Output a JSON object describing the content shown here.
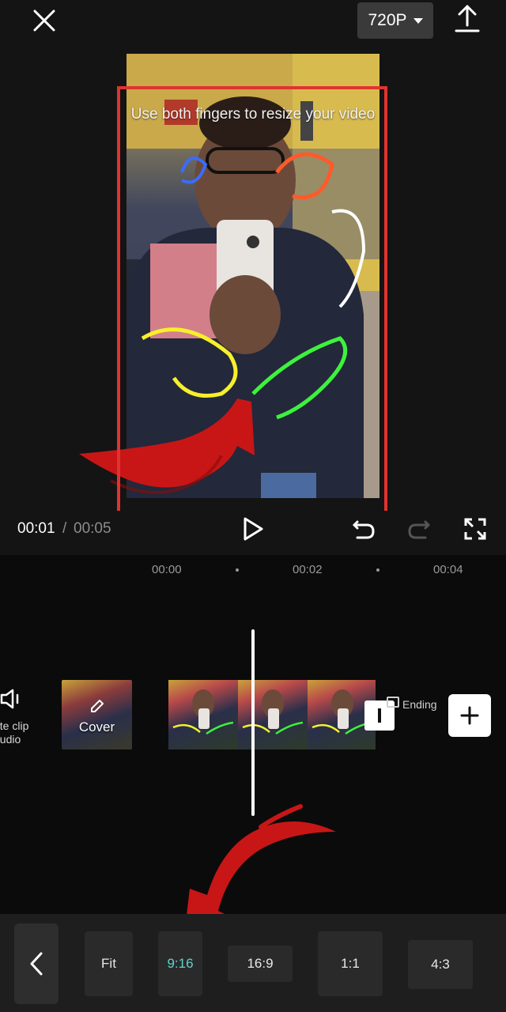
{
  "topbar": {
    "close_icon": "close-icon",
    "resolution_label": "720P",
    "export_icon": "upload-icon"
  },
  "preview": {
    "hint_text": "Use both fingers to resize your video",
    "highlight_color": "#e0332f",
    "arrow_color": "#c81616"
  },
  "controls": {
    "current_time": "00:01",
    "separator": "/",
    "total_time": "00:05"
  },
  "timeline": {
    "ruler": [
      "00:00",
      "00:02",
      "00:04"
    ],
    "mute_label": "ute clip audio",
    "cover_label": "Cover",
    "ending_label": "Ending",
    "add_icon": "plus-icon"
  },
  "ratio_bar": {
    "back_icon": "chevron-left-icon",
    "options": [
      "Fit",
      "9:16",
      "16:9",
      "1:1",
      "4:3"
    ],
    "selected": "9:16",
    "active_color": "#5fd3d0"
  }
}
